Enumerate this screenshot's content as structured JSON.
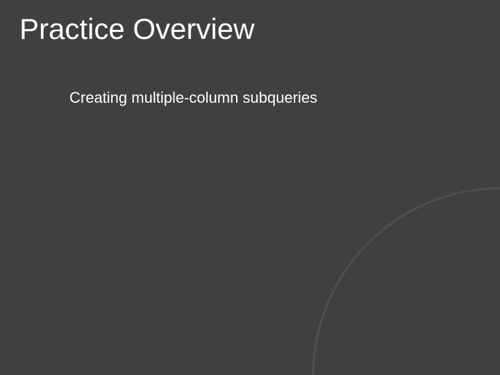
{
  "slide": {
    "title": "Practice Overview",
    "body_text": "Creating multiple-column subqueries"
  },
  "colors": {
    "background": "#404040",
    "text": "#ffffff",
    "arc_stroke": "#4f4f4f"
  }
}
